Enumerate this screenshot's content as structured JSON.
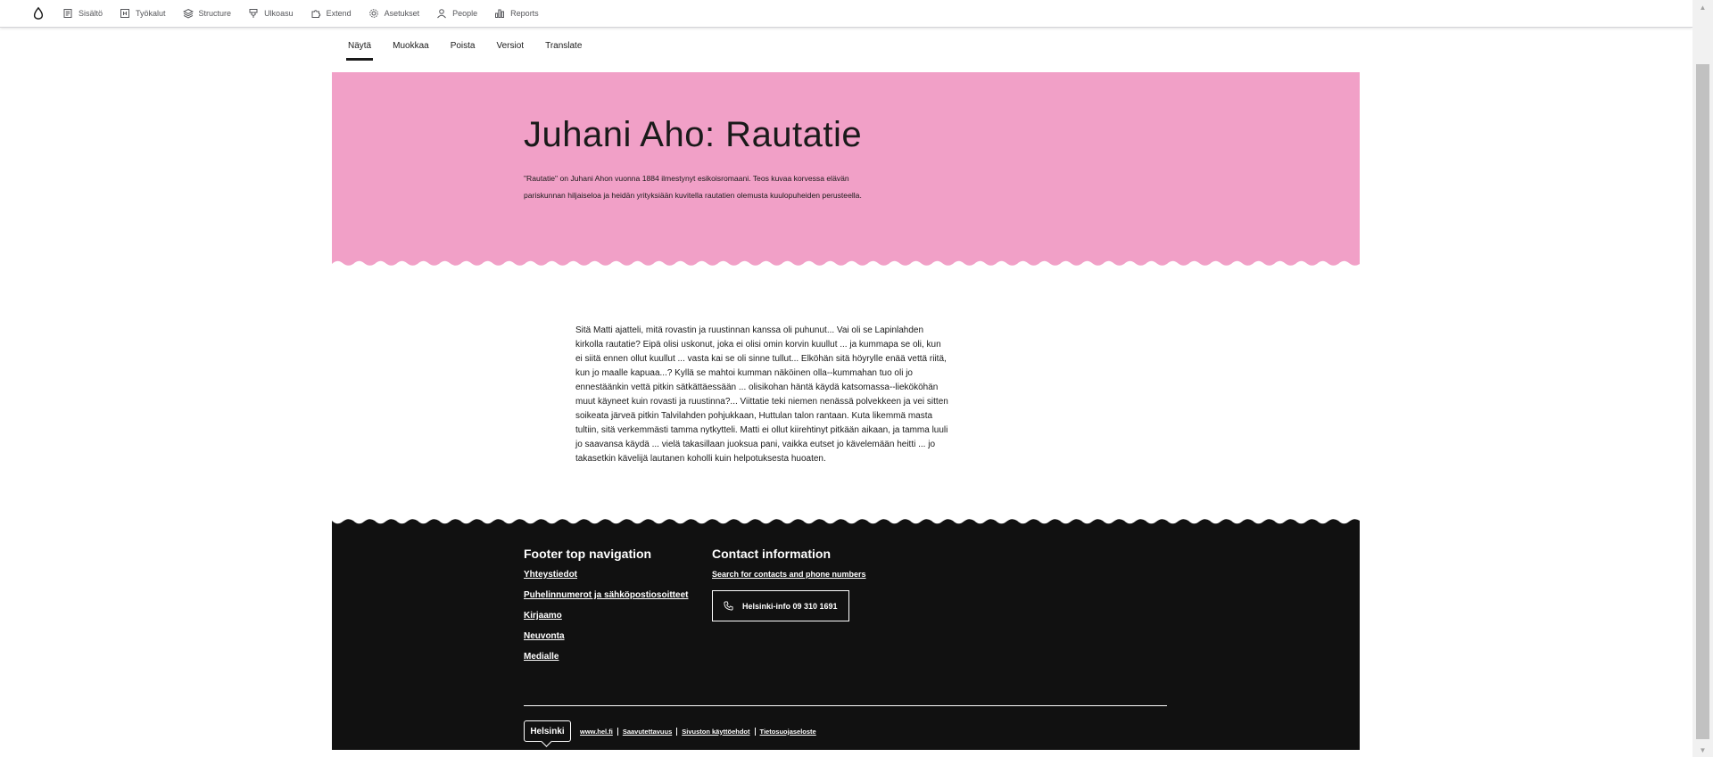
{
  "admin_toolbar": {
    "items": [
      {
        "label": "Sisältö",
        "icon": "document-icon"
      },
      {
        "label": "Työkalut",
        "icon": "tools-icon"
      },
      {
        "label": "Structure",
        "icon": "layers-icon"
      },
      {
        "label": "Ulkoasu",
        "icon": "brush-icon"
      },
      {
        "label": "Extend",
        "icon": "puzzle-icon"
      },
      {
        "label": "Asetukset",
        "icon": "gear-icon"
      },
      {
        "label": "People",
        "icon": "person-icon"
      },
      {
        "label": "Reports",
        "icon": "bar-chart-icon"
      }
    ]
  },
  "tabs": [
    {
      "label": "Näytä",
      "active": true
    },
    {
      "label": "Muokkaa",
      "active": false
    },
    {
      "label": "Poista",
      "active": false
    },
    {
      "label": "Versiot",
      "active": false
    },
    {
      "label": "Translate",
      "active": false
    }
  ],
  "hero": {
    "title": "Juhani Aho: Rautatie",
    "lead": "\"Rautatie\" on Juhani Ahon vuonna 1884 ilmestynyt esikoisromaani. Teos kuvaa korvessa elävän pariskunnan hiljaiseloa ja heidän yrityksiään kuvitella rautatien olemusta kuulopuheiden perusteella.",
    "background": "#f1a0c7"
  },
  "body_text": "Sitä Matti ajatteli, mitä rovastin ja ruustinnan kanssa oli puhunut... Vai oli se Lapinlahden kirkolla rautatie? Eipä olisi uskonut, joka ei olisi omin korvin kuullut ... ja kummapa se oli, kun ei siitä ennen ollut kuullut ... vasta kai se oli sinne tullut... Elköhän sitä höyrylle enää vettä riitä, kun jo maalle kapuaa...? Kyllä se mahtoi kumman näköinen olla--kummahan tuo oli jo ennestäänkin vettä pitkin sätkättäessään ... olisikohan häntä käydä katsomassa--liekököhän muut käyneet kuin rovasti ja ruustinna?... Viittatie teki niemen nenässä polvekkeen ja vei sitten soikeata järveä pitkin Talvilahden pohjukkaan, Huttulan talon rantaan. Kuta likemmä masta tultiin, sitä verkemmästi tamma nytkytteli. Matti ei ollut kiirehtinyt pitkään aikaan, ja tamma luuli jo saavansa käydä ... vielä takasillaan juoksua pani, vaikka eutset jo kävelemään heitti ... jo takasetkin kävelijä lautanen koholli kuin helpotuksesta huoaten.",
  "footer": {
    "nav_heading": "Footer top navigation",
    "nav_links": [
      "Yhteystiedot",
      "Puhelinnumerot ja sähköpostiosoitteet",
      "Kirjaamo",
      "Neuvonta",
      "Medialle"
    ],
    "contact_heading": "Contact information",
    "contact_link": "Search for contacts and phone numbers",
    "phone_button": "Helsinki-info 09 310 1691",
    "logo_text": "Helsinki",
    "bottom_links": [
      "www.hel.fi",
      "Saavutettavuus",
      "Sivuston käyttöehdot",
      "Tietosuojaseloste"
    ],
    "background": "#111111"
  }
}
